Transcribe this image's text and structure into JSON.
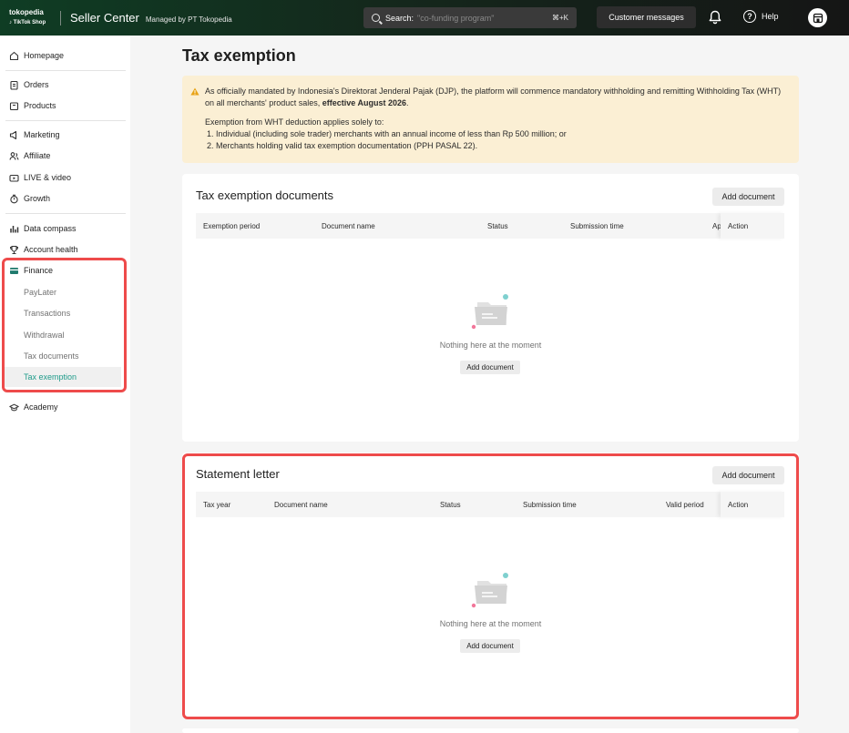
{
  "topbar": {
    "brand_top": "tokopedia",
    "brand_bottom": "TikTok Shop",
    "title": "Seller Center",
    "subtitle": "Managed by PT Tokopedia",
    "search_label": "Search:",
    "search_placeholder": "\"co-funding program\"",
    "search_shortcut": "⌘+K",
    "customer_messages": "Customer messages",
    "help": "Help"
  },
  "sidebar": {
    "homepage": "Homepage",
    "orders": "Orders",
    "products": "Products",
    "marketing": "Marketing",
    "affiliate": "Affiliate",
    "live_video": "LIVE & video",
    "growth": "Growth",
    "data_compass": "Data compass",
    "account_health": "Account health",
    "finance": "Finance",
    "finance_items": [
      "PayLater",
      "Transactions",
      "Withdrawal",
      "Tax documents",
      "Tax exemption"
    ],
    "academy": "Academy"
  },
  "page": {
    "title": "Tax exemption",
    "notice": {
      "line1_pre": "As officially mandated by Indonesia's Direktorat Jenderal Pajak (DJP), the platform will commence mandatory withholding and remitting Withholding Tax (WHT) on all merchants' product sales, ",
      "line1_bold": "effective August 2026",
      "line1_post": ".",
      "line2": "Exemption from WHT deduction applies solely to:",
      "item1": "1.  Individual (including sole trader) merchants with an annual income of less than Rp 500 million; or",
      "item2": "2.  Merchants holding valid tax exemption documentation (PPH PASAL 22)."
    },
    "tax_docs": {
      "title": "Tax exemption documents",
      "add_button": "Add document",
      "columns": [
        "Exemption period",
        "Document name",
        "Status",
        "Submission time",
        "Ap"
      ],
      "action_col": "Action",
      "empty_text": "Nothing here at the moment",
      "empty_button": "Add document"
    },
    "statement": {
      "title": "Statement letter",
      "add_button": "Add document",
      "columns": [
        "Tax year",
        "Document name",
        "Status",
        "Submission time",
        "Valid period"
      ],
      "action_col": "Action",
      "empty_text": "Nothing here at the moment",
      "empty_button": "Add document"
    }
  },
  "colors": {
    "accent": "#1f9b8a",
    "highlight": "#ee4b4b",
    "notice_bg": "#fbefd4"
  }
}
